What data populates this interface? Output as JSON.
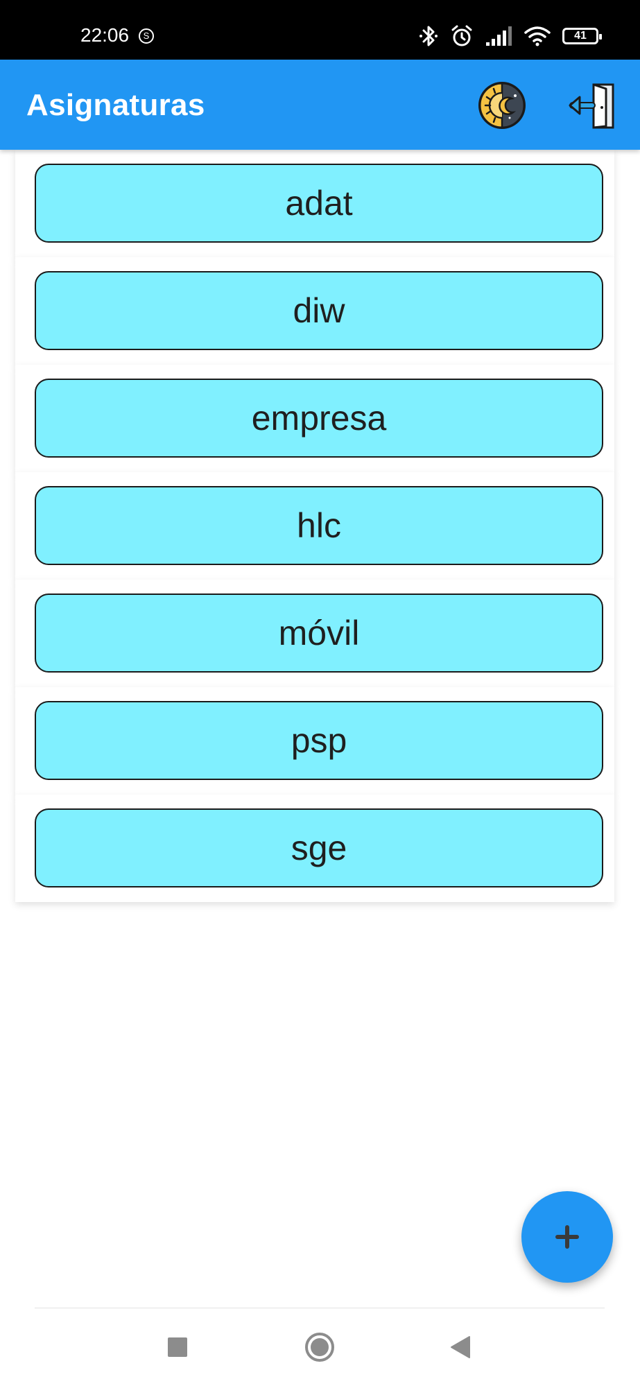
{
  "status_bar": {
    "time": "22:06",
    "sync_badge": "S",
    "battery_level": "41",
    "icons": [
      "bluetooth-icon",
      "alarm-icon",
      "signal-icon",
      "wifi-icon",
      "battery-icon"
    ]
  },
  "app_bar": {
    "title": "Asignaturas",
    "actions": [
      "theme-toggle-icon",
      "logout-door-icon"
    ],
    "color": "#2196f3"
  },
  "subjects": [
    {
      "label": "adat"
    },
    {
      "label": "diw"
    },
    {
      "label": "empresa"
    },
    {
      "label": "hlc"
    },
    {
      "label": "móvil"
    },
    {
      "label": "psp"
    },
    {
      "label": "sge"
    }
  ],
  "card_color": "#80f0ff",
  "fab": {
    "icon": "plus-icon",
    "symbol": "+"
  },
  "nav_bar": {
    "buttons": [
      "recents-square-icon",
      "home-circle-icon",
      "back-triangle-icon"
    ]
  }
}
